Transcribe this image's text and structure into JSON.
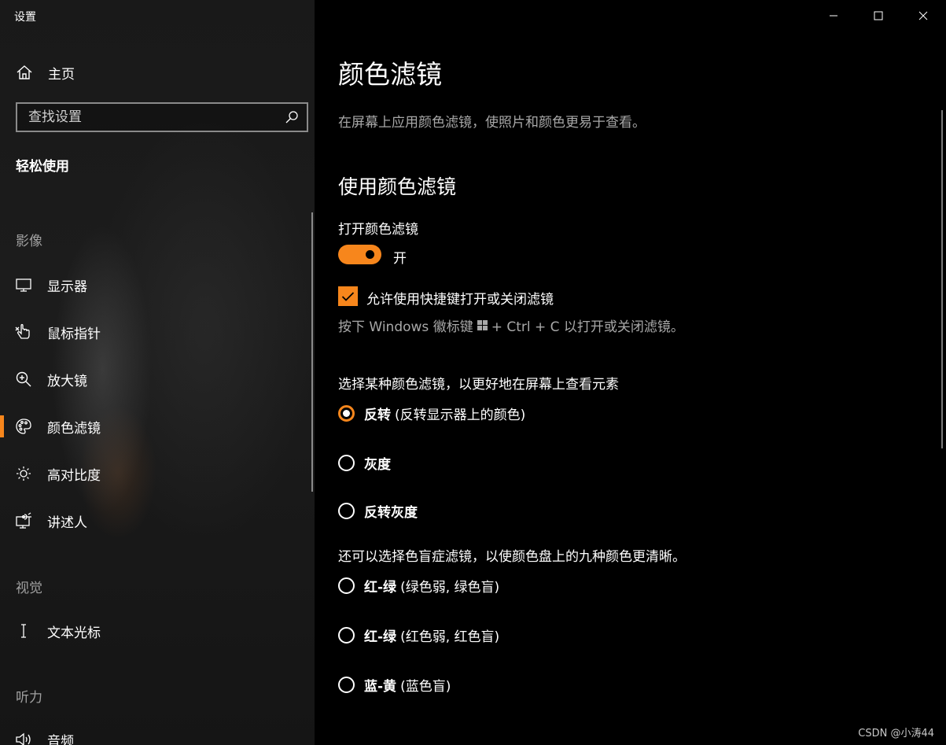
{
  "window": {
    "title": "设置"
  },
  "sidebar": {
    "home_label": "主页",
    "search_placeholder": "查找设置",
    "group_title": "轻松使用",
    "sections": [
      {
        "heading": "影像",
        "items": [
          {
            "label": "显示器",
            "icon": "monitor-icon"
          },
          {
            "label": "鼠标指针",
            "icon": "mouse-pointer-icon"
          },
          {
            "label": "放大镜",
            "icon": "magnifier-icon"
          },
          {
            "label": "颜色滤镜",
            "icon": "palette-icon",
            "active": true
          },
          {
            "label": "高对比度",
            "icon": "brightness-icon"
          },
          {
            "label": "讲述人",
            "icon": "narrator-icon"
          }
        ]
      },
      {
        "heading": "视觉",
        "items": [
          {
            "label": "文本光标",
            "icon": "text-cursor-icon"
          }
        ]
      },
      {
        "heading": "听力",
        "items": [
          {
            "label": "音频",
            "icon": "speaker-icon"
          }
        ]
      }
    ]
  },
  "main": {
    "title": "颜色滤镜",
    "description": "在屏幕上应用颜色滤镜，使照片和颜色更易于查看。",
    "subtitle": "使用颜色滤镜",
    "toggle": {
      "label": "打开颜色滤镜",
      "state_text": "开",
      "on": true
    },
    "shortcut_checkbox": {
      "label": "允许使用快捷键打开或关闭滤镜",
      "checked": true
    },
    "shortcut_hint": {
      "before": "按下 Windows 徽标键",
      "after": "+ Ctrl + C 以打开或关闭滤镜。"
    },
    "filter_prompt": "选择某种颜色滤镜，以更好地在屏幕上查看元素",
    "filters": [
      {
        "name": "反转",
        "desc": "(反转显示器上的颜色)",
        "selected": true
      },
      {
        "name": "灰度",
        "desc": "",
        "selected": false
      },
      {
        "name": "反转灰度",
        "desc": "",
        "selected": false
      }
    ],
    "colorblind_prompt": "还可以选择色盲症滤镜，以使颜色盘上的九种颜色更清晰。",
    "colorblind_filters": [
      {
        "name": "红-绿",
        "desc": "(绿色弱, 绿色盲)",
        "selected": false
      },
      {
        "name": "红-绿",
        "desc": "(红色弱, 红色盲)",
        "selected": false
      },
      {
        "name": "蓝-黄",
        "desc": "(蓝色盲)",
        "selected": false
      }
    ]
  },
  "watermark": "CSDN @小涛44",
  "colors": {
    "accent": "#f7861c",
    "background": "#000000",
    "sidebar": "#1a1a1a",
    "muted_text": "#a8a8a8"
  }
}
